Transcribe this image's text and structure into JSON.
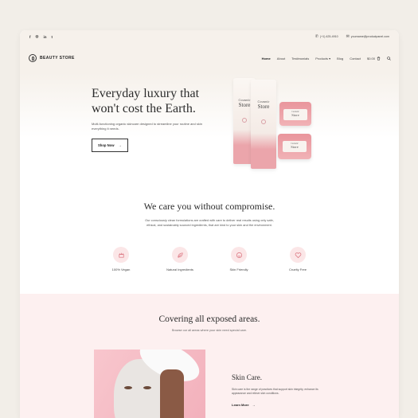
{
  "topbar": {
    "social": [
      "f",
      "◎",
      "in",
      "t"
    ],
    "phone": "(+1) 425-4910",
    "email": "yourname@productpanel.com"
  },
  "header": {
    "brand": "BEAUTY STORE",
    "nav": [
      "Home",
      "About",
      "Testimonials",
      "Products ▾",
      "Blog",
      "Contact"
    ],
    "cart_total": "$0.00"
  },
  "hero": {
    "title_line1": "Everyday luxury that",
    "title_line2": "won't cost the Earth.",
    "subtitle": "Multi-functioning organic skincare designed to streamline your routine and skin everything it needs.",
    "button": "Shop Now",
    "product_label_a": "Cosmetic",
    "product_label_b": "Store"
  },
  "care": {
    "title": "We care you without compromise.",
    "text": "Our consciously clean formulations are crafted with care to deliver real results using only safe, ethical, and sustainably sourced ingredients, that are kind to your skin and the environment.",
    "features": [
      "100% Vegan",
      "Natural Ingredients",
      "Skin Friendly",
      "Cruelty Free"
    ]
  },
  "areas": {
    "title": "Covering all exposed areas.",
    "subtitle": "Browse our all areas where your skin need special care.",
    "skin_title": "Skin Care.",
    "skin_text": "Skin care is the range of practices that support skin integrity, enhance its appearance and relieve skin conditions.",
    "learn_more": "Learn More"
  },
  "colors": {
    "accent_pink": "#f1b2b6",
    "soft_pink": "#fdf0f0",
    "cream": "#f6f1eb"
  }
}
